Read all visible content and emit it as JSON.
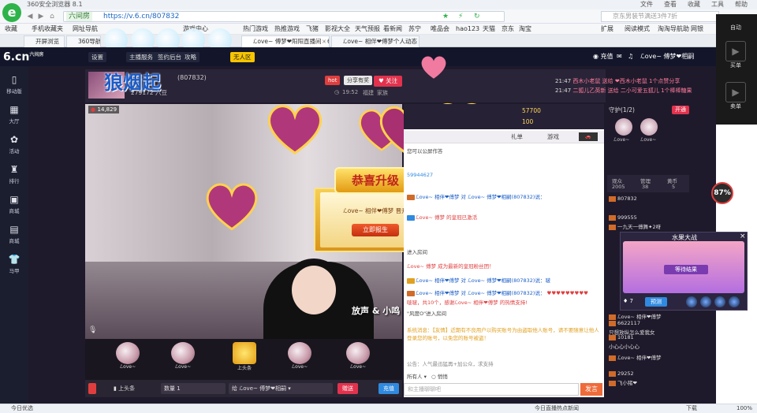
{
  "browser": {
    "title": "360安全浏览器 8.1",
    "menu": [
      "文件",
      "查看",
      "收藏",
      "工具",
      "帮助"
    ],
    "site_label": "六间房",
    "url": "https://v.6.cn/807832",
    "search_text": "京东男装节满送3件7折",
    "favorites": [
      "收藏",
      "手机收藏夹",
      "网址导航",
      "游戏中心",
      "热门游戏",
      "热推游戏",
      "飞猪",
      "影视大全",
      "天气预报",
      "看新闻",
      "苏宁",
      "唯品会",
      "hao123",
      "天猫",
      "京东",
      "淘宝",
      "扩展",
      "阅读模式",
      "淘淘导航助",
      "网银"
    ],
    "tabs": [
      {
        "label": "开屏浏览",
        "active": false
      },
      {
        "label": "360导航_一",
        "active": false
      },
      {
        "label": "ℒove~ 傅梦❤阳阳直播间 - 6",
        "active": true
      },
      {
        "label": "ℒove~ 相伴❤傅梦个人动态",
        "active": false
      }
    ]
  },
  "site_header": {
    "logo": "6.cn",
    "logo_sub": "六间房",
    "buttons": [
      "设置",
      "主播服务",
      "签约后台",
      "攻略"
    ],
    "pill": "无人区",
    "coins_label": "充值",
    "user_name": "ℒove~ 傅梦❤相嗣"
  },
  "left_rail": [
    {
      "icon": "phone-icon",
      "label": "移动版"
    },
    {
      "icon": "hall-icon",
      "label": "大厅"
    },
    {
      "icon": "activity-icon",
      "label": "活动"
    },
    {
      "icon": "rank-icon",
      "label": "排行"
    },
    {
      "icon": "mall-icon",
      "label": "商城"
    },
    {
      "icon": "gift-icon",
      "label": "商城"
    },
    {
      "icon": "shirt-icon",
      "label": "马甲"
    }
  ],
  "anchor": {
    "overlay_name": "狼烟起",
    "room_id": "(807832)",
    "stat": "279172 六豆",
    "hot": "hot",
    "share": "分享有奖",
    "follow": "关注",
    "time": "19:52",
    "location": "福建",
    "family": "家族"
  },
  "feed": [
    {
      "time": "21:47",
      "text": "西木小老鼠 送给 ❤西木小老鼠 1个点赞分享"
    },
    {
      "time": "21:47",
      "text": "二狐儿乙英新 送给 二小可爱五狐儿 1个棒棒糖果"
    }
  ],
  "video": {
    "viewers": "14,829",
    "watermark": "放声 & 小鸣"
  },
  "congrats": {
    "title": "恭喜升级",
    "text": "ℒove~ 相伴❤傅梦 晋升",
    "button": "立即报生"
  },
  "gifts": [
    {
      "label": "ℒove~"
    },
    {
      "label": "ℒove~"
    },
    {
      "label": "上头条"
    },
    {
      "label": "ℒove~"
    },
    {
      "label": "ℒove~"
    }
  ],
  "send": {
    "headline": "上头条",
    "qty_label": "数量",
    "qty_value": "1",
    "to_label": "给",
    "to_value": "ℒove~ 傅梦❤相嗣",
    "give": "赠送",
    "charge": "充值"
  },
  "chat": {
    "coins1": "57700",
    "coins2": "100",
    "tabs": [
      "礼单",
      "游戏"
    ],
    "tip": "您可以公屏作答",
    "number": "59944627",
    "messages": [
      "ℒove~ 相伴❤傅梦 对 ℒove~ 傅梦❤相嗣(807832)说：",
      "ℒove~ 傅梦 的皇冠已激活",
      "进入房间",
      "ℒove~ 傅梦 成为最新的皇冠粉丝团！",
      "ℒove~ 相伴❤傅梦 对 ℒove~ 傅梦❤相嗣(807832)说：啵",
      "ℒove~ 相伴❤傅梦 对 ℒove~ 傅梦❤相嗣(807832)说：",
      "啵啵，共10个，感谢ℒove~ 相伴❤傅梦 的热情支持!",
      "\"风度O\"进入房间"
    ],
    "system": "系统消息：【友情】近期有不良用户以购买账号为由盗取他人账号，请不要随意让他人登录您的账号，以免您的账号被盗！",
    "notice": "公告：人气最迅猛再+加公众，求支持",
    "all_label": "所有人",
    "secret_label": "悄悄",
    "input_placeholder": "和主播聊聊吧",
    "send": "发言"
  },
  "right": {
    "guard_label": "守护(1/2)",
    "open_button": "开通",
    "guard_names": [
      "ℒove~",
      "ℒove~"
    ],
    "stats": [
      {
        "label": "观众",
        "value": "2005"
      },
      {
        "label": "管理",
        "value": "38"
      },
      {
        "label": "黄币",
        "value": "5"
      }
    ],
    "users": [
      "807832",
      "999555",
      "一九天一傅舞✦2呀",
      "ℒove~ 相伴❤傅梦",
      "6622117",
      "只想放纵怎么爱我女",
      "10181",
      "小心心小心心",
      "ℒove~ 相伴❤傅梦",
      "29252",
      "飞小猪❤"
    ]
  },
  "fruit_game": {
    "title": "水果大战",
    "wait": "等待结果",
    "bet": "预测",
    "count": "7"
  },
  "dock": {
    "items": [
      "自动",
      "买单",
      "卖单"
    ],
    "percent": "87%"
  },
  "statusbar": {
    "left": "今日优选",
    "right_items": [
      "今日直播",
      "热点新闻",
      "下载",
      "100%"
    ]
  }
}
